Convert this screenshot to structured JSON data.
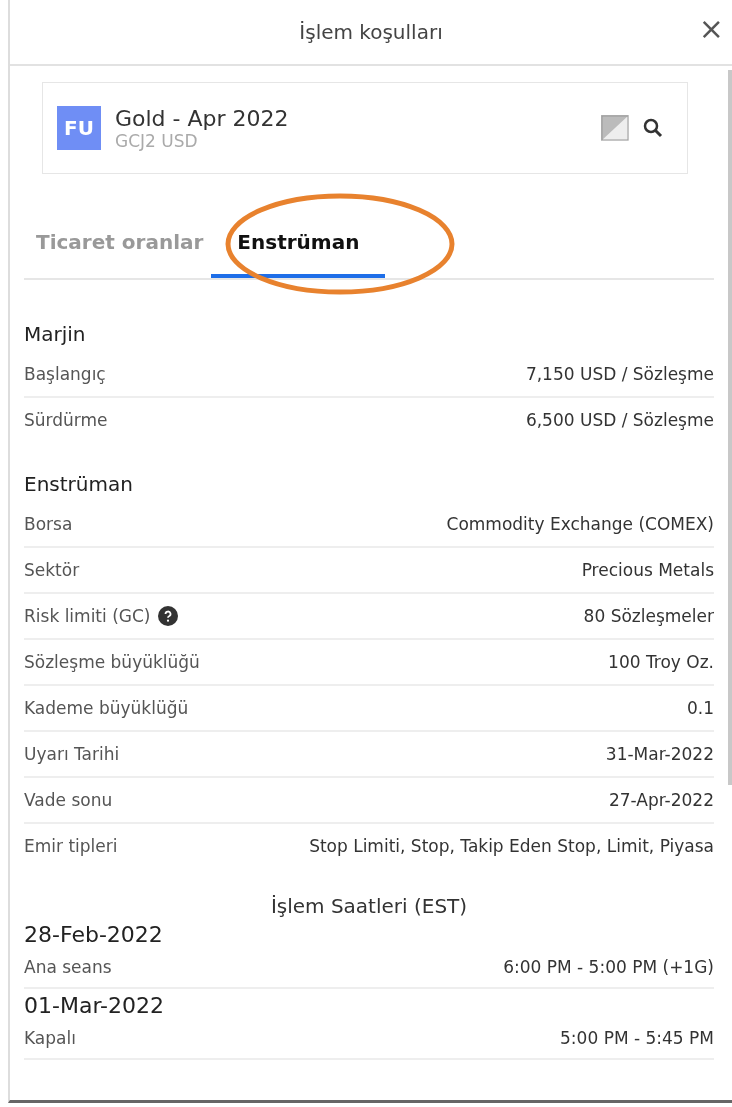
{
  "window": {
    "title": "İşlem koşulları",
    "close": "×"
  },
  "instrument": {
    "badge": "FU",
    "name": "Gold - Apr 2022",
    "symbol": "GCJ2 USD"
  },
  "tabs": [
    {
      "label": "Ticaret oranlar",
      "selected": false
    },
    {
      "label": "Enstrüman",
      "selected": true,
      "circled": true
    }
  ],
  "sections": [
    {
      "title": "Marjin",
      "rows": [
        {
          "label": "Başlangıç",
          "value": "7,150 USD / Sözleşme"
        },
        {
          "label": "Sürdürme",
          "value": "6,500 USD / Sözleşme"
        }
      ]
    },
    {
      "title": "Enstrüman",
      "rows": [
        {
          "label": "Borsa",
          "value": "Commodity Exchange (COMEX)"
        },
        {
          "label": "Sektör",
          "value": "Precious Metals"
        },
        {
          "label": "Risk limiti (GC)",
          "value": "80 Sözleşmeler",
          "help": true
        },
        {
          "label": "Sözleşme büyüklüğü",
          "value": "100 Troy Oz."
        },
        {
          "label": "Kademe büyüklüğü",
          "value": "0.1"
        },
        {
          "label": "Uyarı Tarihi",
          "value": "31-Mar-2022"
        },
        {
          "label": "Vade sonu",
          "value": "27-Apr-2022"
        },
        {
          "label": "Emir tipleri",
          "value": "Stop Limiti, Stop, Takip Eden Stop, Limit, Piyasa"
        }
      ]
    }
  ],
  "hours": {
    "title": "İşlem Saatleri (EST)",
    "days": [
      {
        "date": "28-Feb-2022",
        "rows": [
          {
            "label": "Ana seans",
            "value": "6:00 PM - 5:00 PM (+1G)"
          }
        ]
      },
      {
        "date": "01-Mar-2022",
        "rows": [
          {
            "label": "Kapalı",
            "value": "5:00 PM - 5:45 PM"
          }
        ]
      }
    ]
  }
}
